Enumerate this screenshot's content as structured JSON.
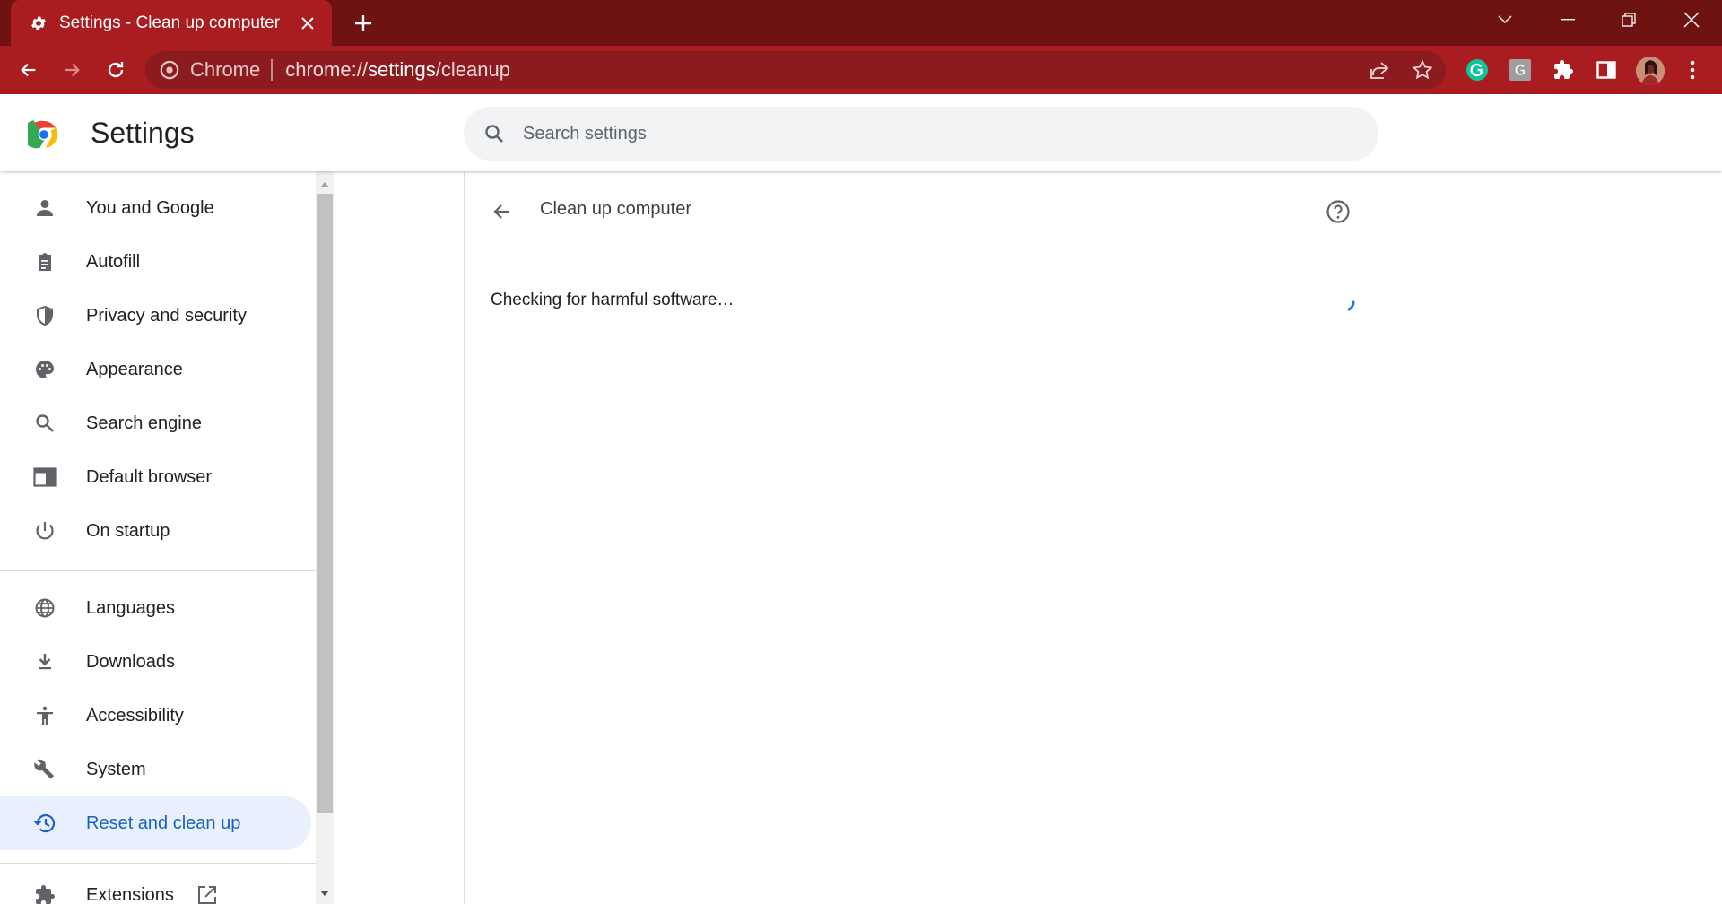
{
  "tab": {
    "title": "Settings - Clean up computer",
    "icon": "gear-icon"
  },
  "omnibox": {
    "chip": "Chrome",
    "url_scheme": "chrome://",
    "url_host": "settings",
    "url_path": "/cleanup"
  },
  "header": {
    "title": "Settings",
    "search_placeholder": "Search settings"
  },
  "sidebar": {
    "items": [
      {
        "label": "You and Google",
        "icon": "person-icon"
      },
      {
        "label": "Autofill",
        "icon": "clipboard-icon"
      },
      {
        "label": "Privacy and security",
        "icon": "shield-icon"
      },
      {
        "label": "Appearance",
        "icon": "palette-icon"
      },
      {
        "label": "Search engine",
        "icon": "search-icon"
      },
      {
        "label": "Default browser",
        "icon": "browser-window-icon"
      },
      {
        "label": "On startup",
        "icon": "power-icon"
      },
      {
        "label": "Languages",
        "icon": "globe-icon"
      },
      {
        "label": "Downloads",
        "icon": "download-icon"
      },
      {
        "label": "Accessibility",
        "icon": "accessibility-icon"
      },
      {
        "label": "System",
        "icon": "wrench-icon"
      },
      {
        "label": "Reset and clean up",
        "icon": "history-icon"
      },
      {
        "label": "Extensions",
        "icon": "puzzle-icon"
      }
    ],
    "active_index": 11
  },
  "main": {
    "title": "Clean up computer",
    "status": "Checking for harmful software…"
  },
  "colors": {
    "frame": "#6e1212",
    "toolbar": "#a91c1f",
    "accent": "#1a73e8",
    "active_bg": "#e8f0fe"
  }
}
